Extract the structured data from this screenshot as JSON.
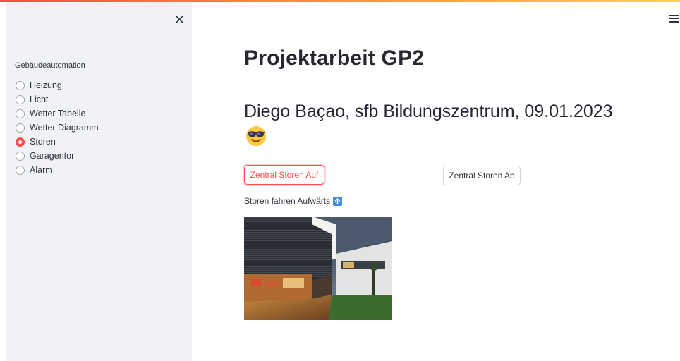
{
  "sidebar": {
    "label": "Gebäudeautomation",
    "options": [
      {
        "label": "Heizung",
        "selected": false
      },
      {
        "label": "Licht",
        "selected": false
      },
      {
        "label": "Wetter Tabelle",
        "selected": false
      },
      {
        "label": "Wetter Diagramm",
        "selected": false
      },
      {
        "label": "Storen",
        "selected": true
      },
      {
        "label": "Garagentor",
        "selected": false
      },
      {
        "label": "Alarm",
        "selected": false
      }
    ]
  },
  "main": {
    "title": "Projektarbeit GP2",
    "subtitle": "Diego Baçao, sfb Bildungszentrum, 09.01.2023",
    "emoji": "sunglasses-face-icon",
    "buttons": {
      "up_label": "Zentral Storen Auf",
      "down_label": "Zentral Storen Ab"
    },
    "status_text": "Storen fahren Aufwärts",
    "status_icon": "arrow-up-icon"
  },
  "colors": {
    "accent": "#ff4b4b",
    "sidebar_bg": "#f0f2f6",
    "text": "#31333f",
    "info_icon": "#3d8bd9"
  }
}
